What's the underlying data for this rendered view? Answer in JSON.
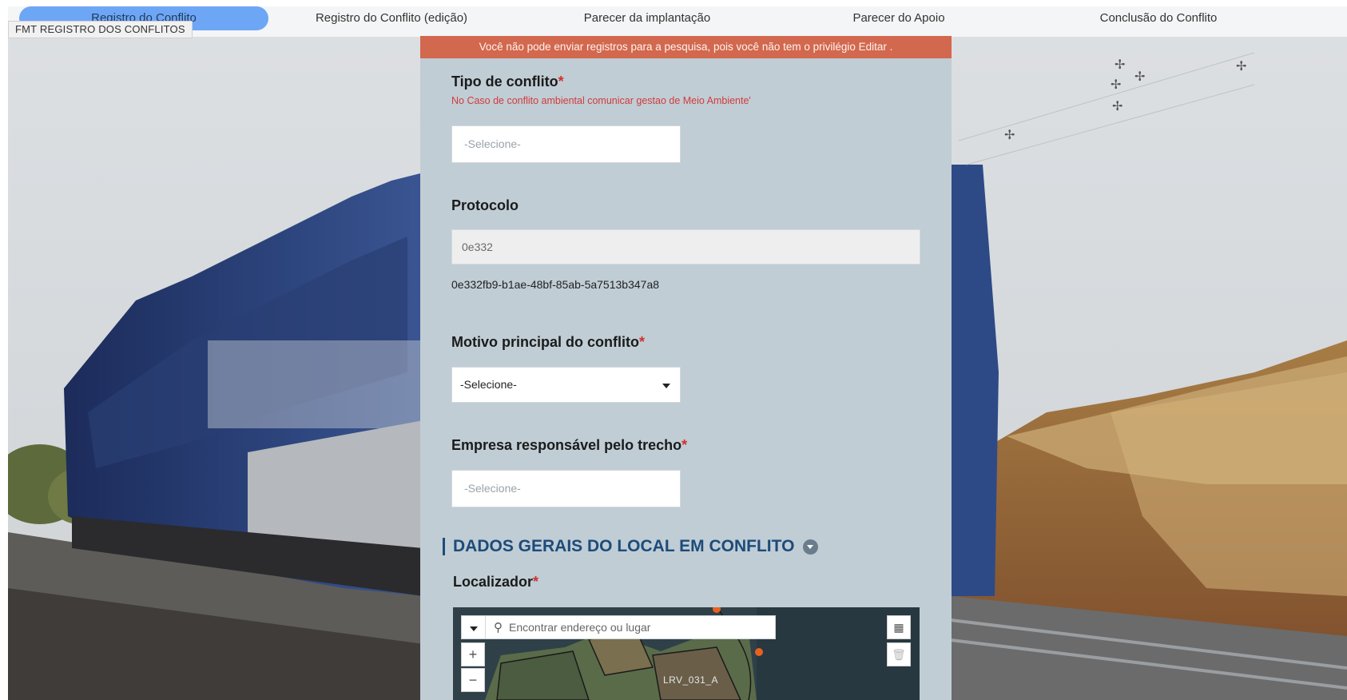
{
  "tabs": [
    {
      "label": "Registro do Conflito",
      "active": true
    },
    {
      "label": "Registro do Conflito (edição)",
      "active": false
    },
    {
      "label": "Parecer da implantação",
      "active": false
    },
    {
      "label": "Parecer do Apoio",
      "active": false
    },
    {
      "label": "Conclusão do Conflito",
      "active": false
    }
  ],
  "sheet_label": "FMT REGISTRO DOS CONFLITOS",
  "banner": "Você não pode enviar registros para a pesquisa, pois você não tem o privilégio Editar .",
  "fields": {
    "tipo": {
      "label": "Tipo de conflito",
      "required_mark": "*",
      "hint": "No Caso de conflito ambiental comunicar gestao de Meio Ambiente'",
      "placeholder": "-Selecione-"
    },
    "protocolo": {
      "label": "Protocolo",
      "value": "0e332",
      "full_value": "0e332fb9-b1ae-48bf-85ab-5a7513b347a8"
    },
    "motivo": {
      "label": "Motivo principal do conflito",
      "required_mark": "*",
      "selected": "-Selecione-"
    },
    "empresa": {
      "label": "Empresa responsável pelo trecho",
      "required_mark": "*",
      "placeholder": "-Selecione-"
    }
  },
  "section": {
    "title": "DADOS GERAIS DO LOCAL EM CONFLITO"
  },
  "localizador": {
    "label": "Localizador",
    "required_mark": "*",
    "search_placeholder": "Encontrar endereço ou lugar",
    "zoom_in": "+",
    "zoom_out": "−",
    "map_label": "LRV_031_A"
  },
  "colors": {
    "banner": "#d2684e",
    "panel": "#c0cdd5",
    "active_tab": "#6ea6f6",
    "section_heading": "#1d4b7a",
    "required": "#d42e2e"
  }
}
